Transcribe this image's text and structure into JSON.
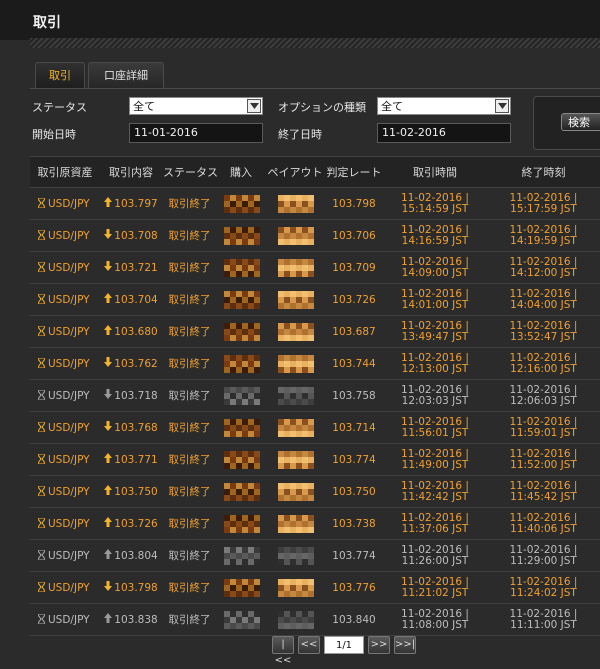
{
  "page": {
    "title": "取引"
  },
  "tabs": [
    {
      "label": "取引",
      "active": true
    },
    {
      "label": "口座詳細",
      "active": false
    }
  ],
  "filters": {
    "status_label": "ステータス",
    "status_value": "全て",
    "option_type_label": "オプションの種類",
    "option_type_value": "全て",
    "start_label": "開始日時",
    "start_value": "11-01-2016",
    "end_label": "終了日時",
    "end_value": "11-02-2016",
    "search_label": "検索"
  },
  "columns": [
    "取引原資産",
    "取引内容",
    "ステータス",
    "購入",
    "ペイアウト",
    "判定レート",
    "取引時間",
    "終了時刻"
  ],
  "rows": [
    {
      "asset": "USD/JPY",
      "dir": "up",
      "rate": "103.797",
      "status": "取引終了",
      "judge": "103.798",
      "open_date": "11-02-2016 |",
      "open_time": "15:14:59 JST",
      "close_date": "11-02-2016 |",
      "close_time": "15:17:59 JST",
      "result": "win"
    },
    {
      "asset": "USD/JPY",
      "dir": "down",
      "rate": "103.708",
      "status": "取引終了",
      "judge": "103.706",
      "open_date": "11-02-2016 |",
      "open_time": "14:16:59 JST",
      "close_date": "11-02-2016 |",
      "close_time": "14:19:59 JST",
      "result": "win"
    },
    {
      "asset": "USD/JPY",
      "dir": "down",
      "rate": "103.721",
      "status": "取引終了",
      "judge": "103.709",
      "open_date": "11-02-2016 |",
      "open_time": "14:09:00 JST",
      "close_date": "11-02-2016 |",
      "close_time": "14:12:00 JST",
      "result": "win"
    },
    {
      "asset": "USD/JPY",
      "dir": "up",
      "rate": "103.704",
      "status": "取引終了",
      "judge": "103.726",
      "open_date": "11-02-2016 |",
      "open_time": "14:01:00 JST",
      "close_date": "11-02-2016 |",
      "close_time": "14:04:00 JST",
      "result": "win"
    },
    {
      "asset": "USD/JPY",
      "dir": "up",
      "rate": "103.680",
      "status": "取引終了",
      "judge": "103.687",
      "open_date": "11-02-2016 |",
      "open_time": "13:49:47 JST",
      "close_date": "11-02-2016 |",
      "close_time": "13:52:47 JST",
      "result": "win"
    },
    {
      "asset": "USD/JPY",
      "dir": "down",
      "rate": "103.762",
      "status": "取引終了",
      "judge": "103.744",
      "open_date": "11-02-2016 |",
      "open_time": "12:13:00 JST",
      "close_date": "11-02-2016 |",
      "close_time": "12:16:00 JST",
      "result": "win"
    },
    {
      "asset": "USD/JPY",
      "dir": "down",
      "rate": "103.718",
      "status": "取引終了",
      "judge": "103.758",
      "open_date": "11-02-2016 |",
      "open_time": "12:03:03 JST",
      "close_date": "11-02-2016 |",
      "close_time": "12:06:03 JST",
      "result": "loss"
    },
    {
      "asset": "USD/JPY",
      "dir": "down",
      "rate": "103.768",
      "status": "取引終了",
      "judge": "103.714",
      "open_date": "11-02-2016 |",
      "open_time": "11:56:01 JST",
      "close_date": "11-02-2016 |",
      "close_time": "11:59:01 JST",
      "result": "win"
    },
    {
      "asset": "USD/JPY",
      "dir": "up",
      "rate": "103.771",
      "status": "取引終了",
      "judge": "103.774",
      "open_date": "11-02-2016 |",
      "open_time": "11:49:00 JST",
      "close_date": "11-02-2016 |",
      "close_time": "11:52:00 JST",
      "result": "win"
    },
    {
      "asset": "USD/JPY",
      "dir": "up",
      "rate": "103.750",
      "status": "取引終了",
      "judge": "103.750",
      "open_date": "11-02-2016 |",
      "open_time": "11:42:42 JST",
      "close_date": "11-02-2016 |",
      "close_time": "11:45:42 JST",
      "result": "win"
    },
    {
      "asset": "USD/JPY",
      "dir": "up",
      "rate": "103.726",
      "status": "取引終了",
      "judge": "103.738",
      "open_date": "11-02-2016 |",
      "open_time": "11:37:06 JST",
      "close_date": "11-02-2016 |",
      "close_time": "11:40:06 JST",
      "result": "win"
    },
    {
      "asset": "USD/JPY",
      "dir": "up",
      "rate": "103.804",
      "status": "取引終了",
      "judge": "103.774",
      "open_date": "11-02-2016 |",
      "open_time": "11:26:00 JST",
      "close_date": "11-02-2016 |",
      "close_time": "11:29:00 JST",
      "result": "loss"
    },
    {
      "asset": "USD/JPY",
      "dir": "down",
      "rate": "103.798",
      "status": "取引終了",
      "judge": "103.776",
      "open_date": "11-02-2016 |",
      "open_time": "11:21:02 JST",
      "close_date": "11-02-2016 |",
      "close_time": "11:24:02 JST",
      "result": "win"
    },
    {
      "asset": "USD/JPY",
      "dir": "up",
      "rate": "103.838",
      "status": "取引終了",
      "judge": "103.840",
      "open_date": "11-02-2016 |",
      "open_time": "11:08:00 JST",
      "close_date": "11-02-2016 |",
      "close_time": "11:11:00 JST",
      "result": "loss"
    }
  ],
  "pager": {
    "first": "|<<",
    "prev": "<<",
    "page": "1/1",
    "next": ">>",
    "last": ">>|"
  },
  "colors": {
    "accent": "#f5b52a",
    "win": "#f0a030",
    "loss": "#bdbdbd",
    "background": "#2b2b2b"
  }
}
